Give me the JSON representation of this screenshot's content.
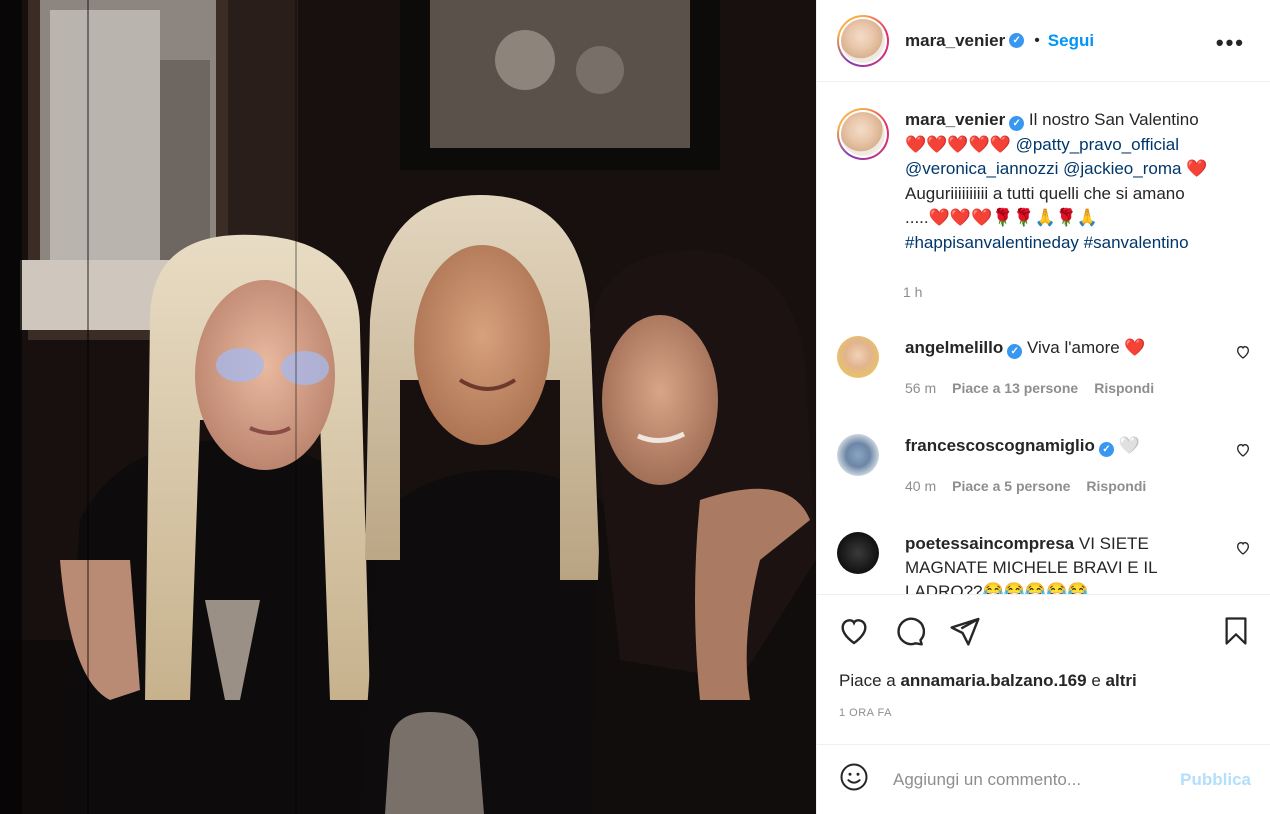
{
  "post": {
    "author": {
      "username": "mara_venier",
      "verified": true,
      "follow_label": "Segui",
      "separator": "•",
      "more_icon": "more-horizontal-icon"
    },
    "caption": {
      "username": "mara_venier",
      "line1": "Il nostro San Valentino",
      "hearts_row1": "❤️❤️❤️❤️❤️",
      "mention1": "@patty_pravo_official",
      "mention2": "@veronica_iannozzi",
      "mention3": "@jackieo_roma",
      "heart_after": "❤️",
      "line3": "Auguriiiiiiiiii a tutti quelli che si amano",
      "line4": ".....❤️❤️❤️🌹🌹🙏🌹🙏",
      "hashtag1": "#happisanvalentineday",
      "hashtag2": "#sanvalentino",
      "time": "1 h"
    },
    "comments": [
      {
        "username": "angelmelillo",
        "verified": true,
        "text": "Viva l'amore ❤️",
        "time": "56 m",
        "likes": "Piace a 13 persone",
        "reply": "Rispondi"
      },
      {
        "username": "francescoscognamiglio",
        "verified": true,
        "text": "🤍",
        "time": "40 m",
        "likes": "Piace a 5 persone",
        "reply": "Rispondi"
      },
      {
        "username": "poetessaincompresa",
        "verified": false,
        "text": "VI SIETE MAGNATE MICHELE BRAVI E IL LADRO??😂😂😂😂😂",
        "time": "",
        "likes": "",
        "reply": ""
      }
    ],
    "actions": {
      "like_icon": "heart-icon",
      "comment_icon": "comment-icon",
      "share_icon": "share-icon",
      "save_icon": "bookmark-icon"
    },
    "likes": {
      "prefix": "Piace a",
      "user": "annamaria.balzano.169",
      "conjunction": "e",
      "others": "altri"
    },
    "posted": "1 ORA FA",
    "add_comment": {
      "emoji_icon": "emoji-icon",
      "placeholder": "Aggiungi un commento...",
      "publish_label": "Pubblica"
    }
  }
}
